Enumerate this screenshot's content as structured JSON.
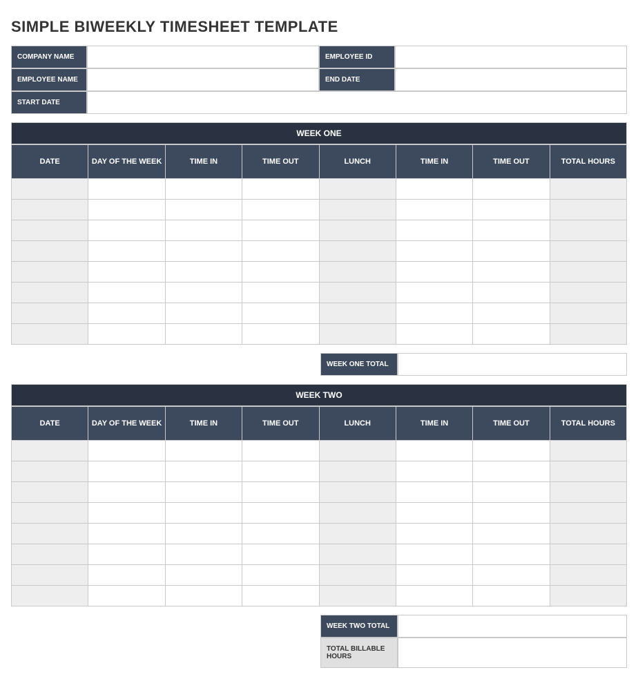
{
  "title": "SIMPLE BIWEEKLY TIMESHEET TEMPLATE",
  "header": {
    "company_name_label": "COMPANY NAME",
    "company_name_value": "",
    "employee_id_label": "EMPLOYEE ID",
    "employee_id_value": "",
    "employee_name_label": "EMPLOYEE NAME",
    "employee_name_value": "",
    "end_date_label": "END DATE",
    "end_date_value": "",
    "start_date_label": "START DATE",
    "start_date_value": ""
  },
  "columns": {
    "date": "DATE",
    "day_of_week": "DAY OF THE WEEK",
    "time_in1": "TIME IN",
    "time_out1": "TIME OUT",
    "lunch": "LUNCH",
    "time_in2": "TIME IN",
    "time_out2": "TIME OUT",
    "total_hours": "TOTAL HOURS"
  },
  "week_one": {
    "banner": "WEEK ONE",
    "rows": [
      {
        "date": "",
        "day": "",
        "tin1": "",
        "tout1": "",
        "lunch": "",
        "tin2": "",
        "tout2": "",
        "total": ""
      },
      {
        "date": "",
        "day": "",
        "tin1": "",
        "tout1": "",
        "lunch": "",
        "tin2": "",
        "tout2": "",
        "total": ""
      },
      {
        "date": "",
        "day": "",
        "tin1": "",
        "tout1": "",
        "lunch": "",
        "tin2": "",
        "tout2": "",
        "total": ""
      },
      {
        "date": "",
        "day": "",
        "tin1": "",
        "tout1": "",
        "lunch": "",
        "tin2": "",
        "tout2": "",
        "total": ""
      },
      {
        "date": "",
        "day": "",
        "tin1": "",
        "tout1": "",
        "lunch": "",
        "tin2": "",
        "tout2": "",
        "total": ""
      },
      {
        "date": "",
        "day": "",
        "tin1": "",
        "tout1": "",
        "lunch": "",
        "tin2": "",
        "tout2": "",
        "total": ""
      },
      {
        "date": "",
        "day": "",
        "tin1": "",
        "tout1": "",
        "lunch": "",
        "tin2": "",
        "tout2": "",
        "total": ""
      },
      {
        "date": "",
        "day": "",
        "tin1": "",
        "tout1": "",
        "lunch": "",
        "tin2": "",
        "tout2": "",
        "total": ""
      }
    ],
    "total_label": "WEEK ONE TOTAL",
    "total_value": ""
  },
  "week_two": {
    "banner": "WEEK TWO",
    "rows": [
      {
        "date": "",
        "day": "",
        "tin1": "",
        "tout1": "",
        "lunch": "",
        "tin2": "",
        "tout2": "",
        "total": ""
      },
      {
        "date": "",
        "day": "",
        "tin1": "",
        "tout1": "",
        "lunch": "",
        "tin2": "",
        "tout2": "",
        "total": ""
      },
      {
        "date": "",
        "day": "",
        "tin1": "",
        "tout1": "",
        "lunch": "",
        "tin2": "",
        "tout2": "",
        "total": ""
      },
      {
        "date": "",
        "day": "",
        "tin1": "",
        "tout1": "",
        "lunch": "",
        "tin2": "",
        "tout2": "",
        "total": ""
      },
      {
        "date": "",
        "day": "",
        "tin1": "",
        "tout1": "",
        "lunch": "",
        "tin2": "",
        "tout2": "",
        "total": ""
      },
      {
        "date": "",
        "day": "",
        "tin1": "",
        "tout1": "",
        "lunch": "",
        "tin2": "",
        "tout2": "",
        "total": ""
      },
      {
        "date": "",
        "day": "",
        "tin1": "",
        "tout1": "",
        "lunch": "",
        "tin2": "",
        "tout2": "",
        "total": ""
      },
      {
        "date": "",
        "day": "",
        "tin1": "",
        "tout1": "",
        "lunch": "",
        "tin2": "",
        "tout2": "",
        "total": ""
      }
    ],
    "total_label": "WEEK TWO TOTAL",
    "total_value": ""
  },
  "billable": {
    "label": "TOTAL BILLABLE HOURS",
    "value": ""
  }
}
